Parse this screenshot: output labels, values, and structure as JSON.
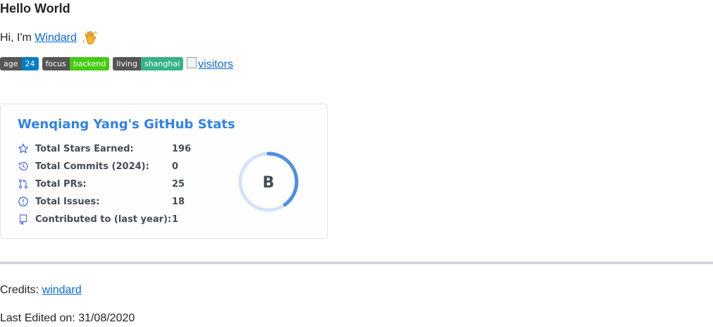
{
  "header": {
    "title": "Hello World"
  },
  "intro": {
    "prefix": "Hi, I'm ",
    "name_link": "Windard"
  },
  "badges": [
    {
      "label": "age",
      "value": "24",
      "color": "#007ec6"
    },
    {
      "label": "focus",
      "value": "backend",
      "color": "#4c1"
    },
    {
      "label": "living",
      "value": "shanghai",
      "color": "#35b38a"
    }
  ],
  "visitors_alt": "visitors",
  "stats_card": {
    "title": "Wenqiang Yang's GitHub Stats",
    "items": [
      {
        "label": "Total Stars Earned:",
        "value": "196",
        "icon": "star-icon"
      },
      {
        "label": "Total Commits (2024):",
        "value": "0",
        "icon": "history-icon"
      },
      {
        "label": "Total PRs:",
        "value": "25",
        "icon": "pull-request-icon"
      },
      {
        "label": "Total Issues:",
        "value": "18",
        "icon": "issue-icon"
      },
      {
        "label": "Contributed to (last year):",
        "value": "1",
        "icon": "repo-icon"
      }
    ],
    "rank": "B",
    "rank_progress_fraction": 0.4,
    "accent": "#2f80ed"
  },
  "footer": {
    "credits_prefix": "Credits: ",
    "credits_link": "windard",
    "edited": "Last Edited on: 31/08/2020"
  }
}
